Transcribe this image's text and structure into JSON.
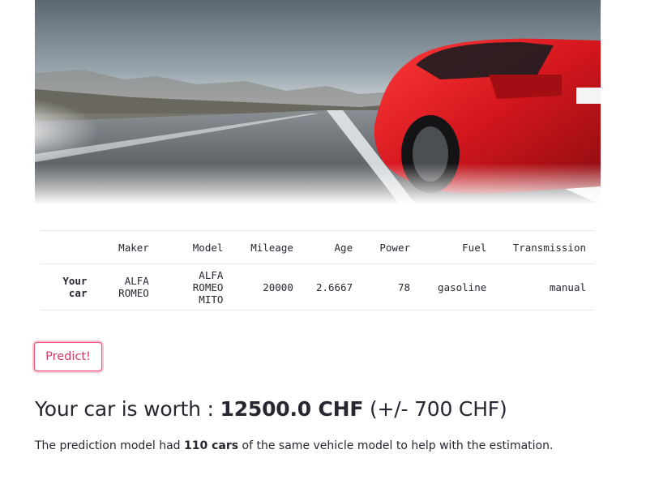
{
  "hero": {
    "image": "red-sports-car-on-road"
  },
  "table": {
    "columns": [
      "",
      "Maker",
      "Model",
      "Mileage",
      "Age",
      "Power",
      "Fuel",
      "Transmission"
    ],
    "rows": [
      {
        "label_line1": "Your",
        "label_line2": "car",
        "maker_line1": "ALFA",
        "maker_line2": "ROMEO",
        "model_line1": "ALFA ROMEO",
        "model_line2": "MITO",
        "mileage": "20000",
        "age": "2.6667",
        "power": "78",
        "fuel": "gasoline",
        "transmission": "manual"
      }
    ]
  },
  "predict_button": {
    "label": "Predict!"
  },
  "result": {
    "prefix": "Your car is worth : ",
    "value": "12500.0 CHF",
    "suffix": " (+/- 700 CHF)"
  },
  "note": {
    "prefix": "The prediction model had ",
    "count": "110 cars",
    "suffix": " of the same vehicle model to help with the estimation."
  },
  "colors": {
    "accent": "#f0527a",
    "text": "#262730",
    "border": "#e6e9ef"
  }
}
